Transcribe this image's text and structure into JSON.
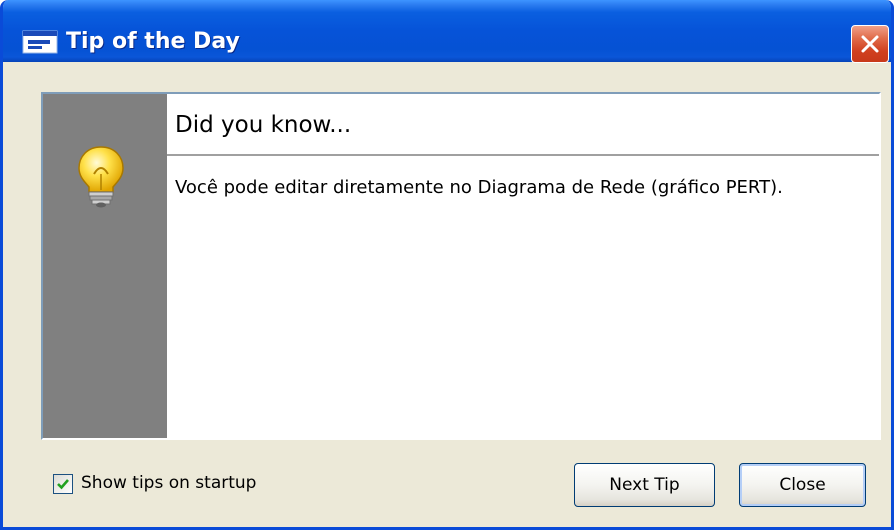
{
  "window": {
    "title": "Tip of the Day",
    "title_icon": "window-icon",
    "close_icon": "close-icon"
  },
  "tip": {
    "icon": "lightbulb-icon",
    "heading": "Did you know...",
    "body": "Você pode editar diretamente no Diagrama de Rede (gráfico PERT)."
  },
  "footer": {
    "show_tips_label": "Show tips on startup",
    "show_tips_checked": true,
    "next_tip_label": "Next Tip",
    "close_label": "Close"
  },
  "colors": {
    "titlebar": "#0653d8",
    "sidebar": "#808080",
    "dialog_bg": "#ece9d8",
    "close_button": "#d0401f"
  }
}
